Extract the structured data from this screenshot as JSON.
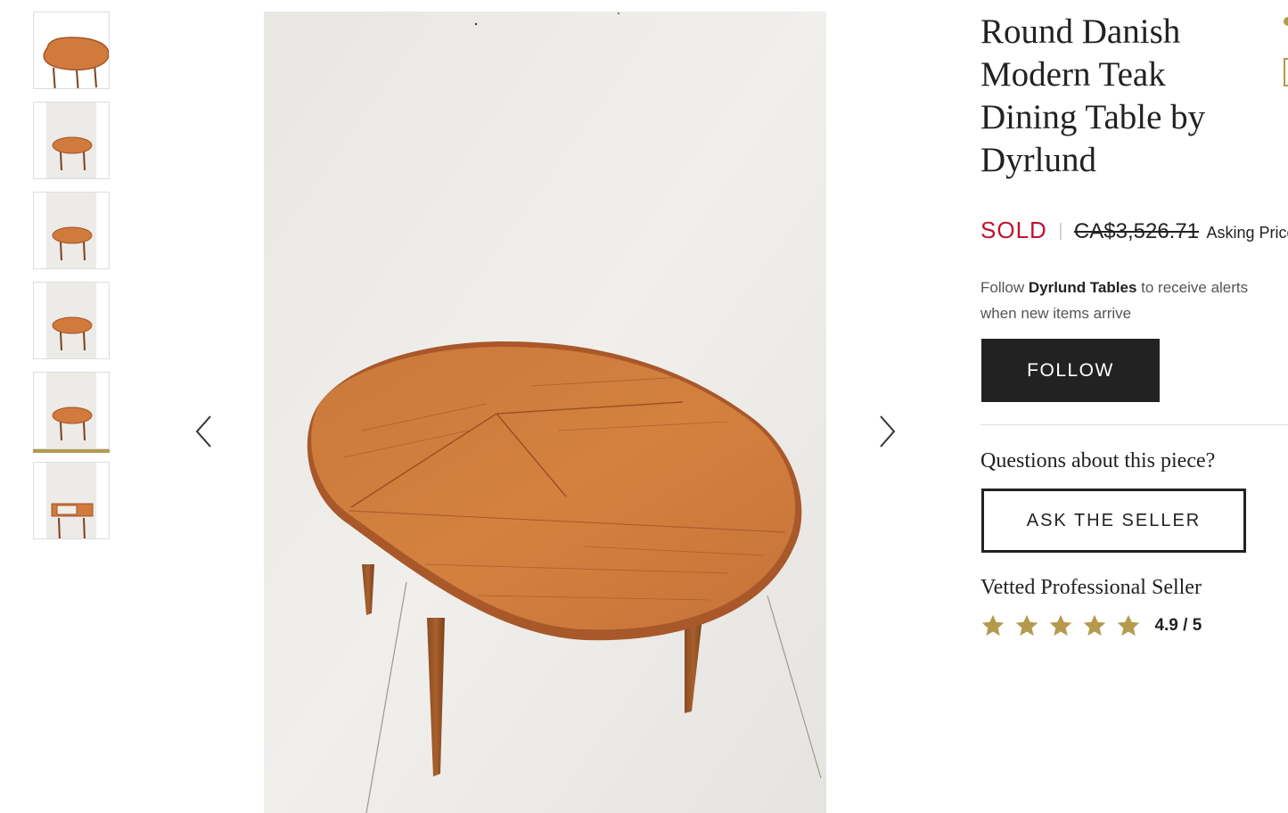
{
  "gallery": {
    "thumbnail_count": 6,
    "active_index": 4,
    "thumb_images": [
      {
        "icon": "table-photo-icon",
        "variant": "angled"
      },
      {
        "icon": "table-photo-icon",
        "variant": "front"
      },
      {
        "icon": "table-photo-icon",
        "variant": "front"
      },
      {
        "icon": "table-photo-icon",
        "variant": "side"
      },
      {
        "icon": "table-photo-icon",
        "variant": "top"
      },
      {
        "icon": "table-photo-icon",
        "variant": "extended"
      }
    ],
    "prev_icon": "chevron-left-icon",
    "next_icon": "chevron-right-icon",
    "accent_color": "#b59a4e"
  },
  "product": {
    "title": "Round Danish Modern Teak Dining Table by Dyrlund",
    "status": "SOLD",
    "old_price": "CA$3,526.71",
    "price_label": "Asking Price",
    "status_color": "#c2102c"
  },
  "follow": {
    "text_before": "Follow",
    "seller_name": "Dyrlund Tables",
    "text_after": "to receive alerts when new items arrive",
    "button_label": "FOLLOW"
  },
  "questions": {
    "heading": "Questions about this piece?",
    "button_label": "ASK THE SELLER"
  },
  "seller": {
    "badge": "Vetted Professional Seller",
    "rating_text": "4.9 / 5",
    "stars": 5,
    "star_icon": "star-icon",
    "star_color": "#b59a4e"
  }
}
